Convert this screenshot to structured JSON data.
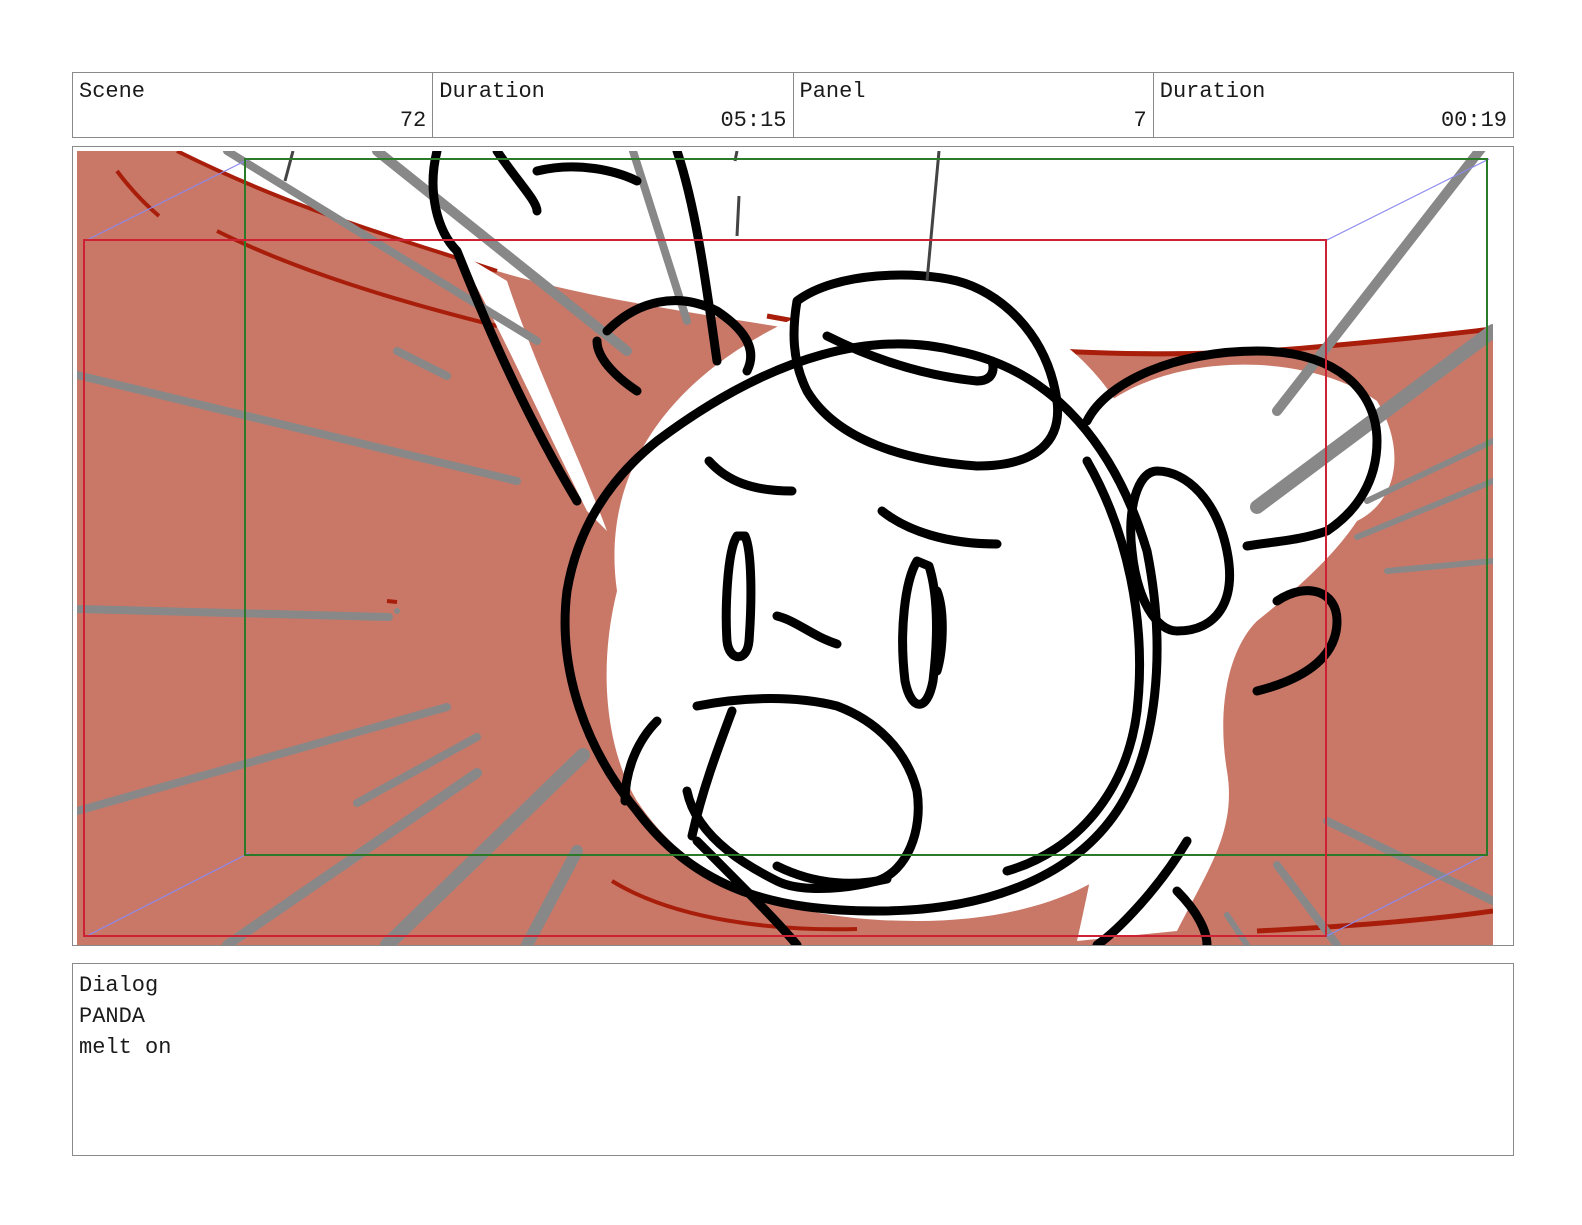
{
  "header": {
    "scene_label": "Scene",
    "scene_value": "72",
    "scene_duration_label": "Duration",
    "scene_duration_value": "05:15",
    "panel_label": "Panel",
    "panel_value": "7",
    "panel_duration_label": "Duration",
    "panel_duration_value": "00:19"
  },
  "dialog": {
    "label": "Dialog",
    "character": "PANDA",
    "line": "melt on"
  },
  "colors": {
    "background_red": "#c97868",
    "dark_red_stroke": "#a81e0a",
    "speed_line_gray": "#8a8a8a",
    "frame_green": "#2a7a2a",
    "frame_red": "#cc2233",
    "camera_arrow": "#8a8aee"
  }
}
